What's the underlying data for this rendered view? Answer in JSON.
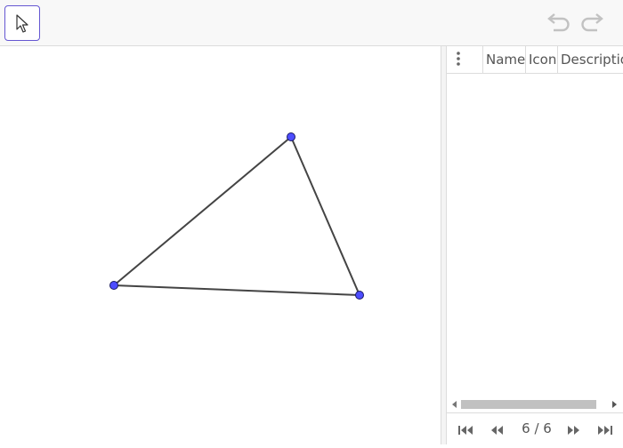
{
  "toolbar": {
    "active_tool_icon": "pointer-arrow-icon",
    "undo_icon": "undo-icon",
    "redo_icon": "redo-icon",
    "accent_color": "#6557d2"
  },
  "graphics_view": {
    "triangle": {
      "stroke_color": "#444444",
      "point_color": "#4d4dff"
    }
  },
  "algebra_table": {
    "columns": [
      "Name",
      "Icon",
      "Description"
    ],
    "rows": []
  },
  "step_navigation": {
    "current_step": "6 / 6"
  }
}
